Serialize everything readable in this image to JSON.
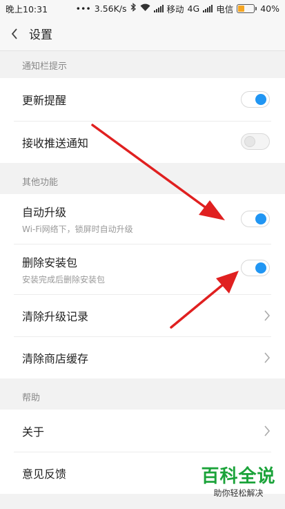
{
  "status_bar": {
    "time": "晚上10:31",
    "dots": "•••",
    "speed": "3.56K/s",
    "carrier1": "移动",
    "network": "4G",
    "carrier2": "电信",
    "battery_percent": "40%",
    "battery_level": 0.4,
    "battery_color": "#f5a623",
    "icons": [
      "bluetooth-icon",
      "wifi-icon",
      "signal-icon",
      "battery-icon"
    ]
  },
  "header": {
    "title": "设置",
    "back_icon": "chevron-left-icon"
  },
  "sections": {
    "notifications": {
      "header": "通知栏提示",
      "items": [
        {
          "label": "更新提醒",
          "toggle": true
        },
        {
          "label": "接收推送通知",
          "toggle": false
        }
      ]
    },
    "other": {
      "header": "其他功能",
      "items": [
        {
          "label": "自动升级",
          "sub": "Wi-Fi网络下，锁屏时自动升级",
          "toggle": true
        },
        {
          "label": "删除安装包",
          "sub": "安装完成后删除安装包",
          "toggle": true
        },
        {
          "label": "清除升级记录"
        },
        {
          "label": "清除商店缓存"
        }
      ]
    },
    "help": {
      "header": "帮助",
      "items": [
        {
          "label": "关于"
        },
        {
          "label": "意见反馈"
        }
      ]
    }
  },
  "watermark": {
    "title": "百科全说",
    "subtitle": "助你轻松解决"
  },
  "colors": {
    "accent": "#2196f3",
    "arrow": "#e02020",
    "watermark": "#1ba33a"
  }
}
